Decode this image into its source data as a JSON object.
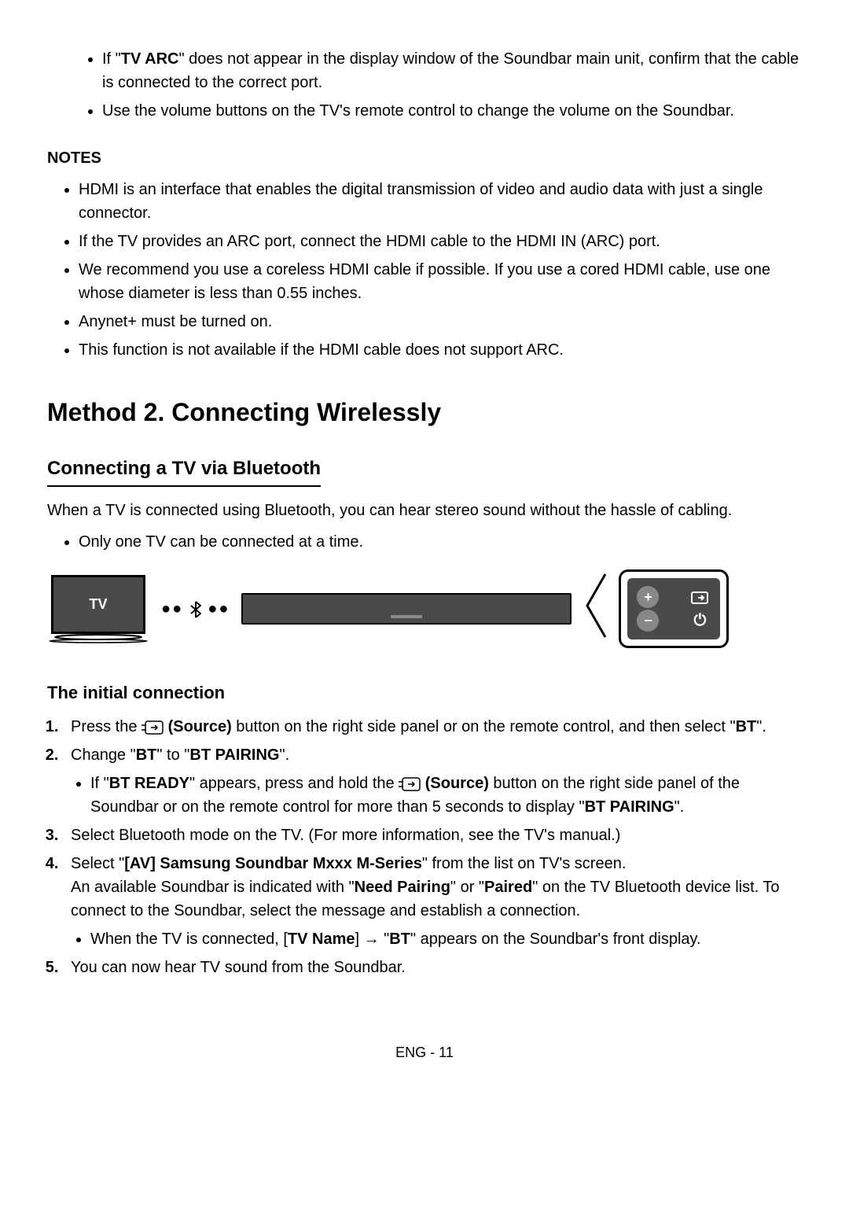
{
  "topBullets": {
    "b1_part1": "If \"",
    "b1_bold": "TV ARC",
    "b1_part2": "\" does not appear in the display window of the Soundbar main unit, confirm that the cable is connected to the correct port.",
    "b2": "Use the volume buttons on the TV's remote control to change the volume on the Soundbar."
  },
  "notesHeading": "NOTES",
  "notes": {
    "n1": "HDMI is an interface that enables the digital transmission of video and audio data with just a single connector.",
    "n2": "If the TV provides an ARC port, connect the HDMI cable to the HDMI IN (ARC) port.",
    "n3": "We recommend you use a coreless HDMI cable if possible. If you use a cored HDMI cable, use one whose diameter is less than 0.55 inches.",
    "n4": "Anynet+ must be turned on.",
    "n5": "This function is not available if the HDMI cable does not support ARC."
  },
  "method2Heading": "Method 2. Connecting Wirelessly",
  "bluetoothHeading": "Connecting a TV via Bluetooth",
  "bluetoothIntro": "When a TV is connected using Bluetooth, you can hear stereo sound without the hassle of cabling.",
  "bluetoothSub": "Only one TV can be connected at a time.",
  "diagram": {
    "tvLabel": "TV",
    "btDots": "••✻••"
  },
  "initialHeading": "The initial connection",
  "steps": {
    "s1_p1": "Press the ",
    "s1_source": "(Source)",
    "s1_p2": " button on the right side panel or on the remote control, and then select \"",
    "s1_bt": "BT",
    "s1_p3": "\".",
    "s2_p1": "Change \"",
    "s2_bt": "BT",
    "s2_p2": "\" to \"",
    "s2_btpair": "BT PAIRING",
    "s2_p3": "\".",
    "s2_sub_p1": "If \"",
    "s2_sub_btready": "BT READY",
    "s2_sub_p2": "\" appears, press and hold the ",
    "s2_sub_source": "(Source)",
    "s2_sub_p3": " button on the right side panel of the Soundbar or on the remote control for more than 5 seconds to display \"",
    "s2_sub_btpair": "BT PAIRING",
    "s2_sub_p4": "\".",
    "s3": "Select Bluetooth mode on the TV. (For more information, see the TV's manual.)",
    "s4_p1": "Select \"",
    "s4_bold": "[AV] Samsung Soundbar Mxxx M-Series",
    "s4_p2": "\" from the list on TV's screen.",
    "s4_line2_p1": "An available Soundbar is indicated with \"",
    "s4_line2_b1": "Need Pairing",
    "s4_line2_p2": "\" or \"",
    "s4_line2_b2": "Paired",
    "s4_line2_p3": "\" on the TV Bluetooth device list. To connect to the Soundbar, select the message and establish a connection.",
    "s4_sub_p1": "When the TV is connected, [",
    "s4_sub_b1": "TV Name",
    "s4_sub_p2": "] → \"",
    "s4_sub_b2": "BT",
    "s4_sub_p3": "\" appears on the Soundbar's front display.",
    "s5": "You can now hear TV sound from the Soundbar."
  },
  "footer": "ENG - 11"
}
